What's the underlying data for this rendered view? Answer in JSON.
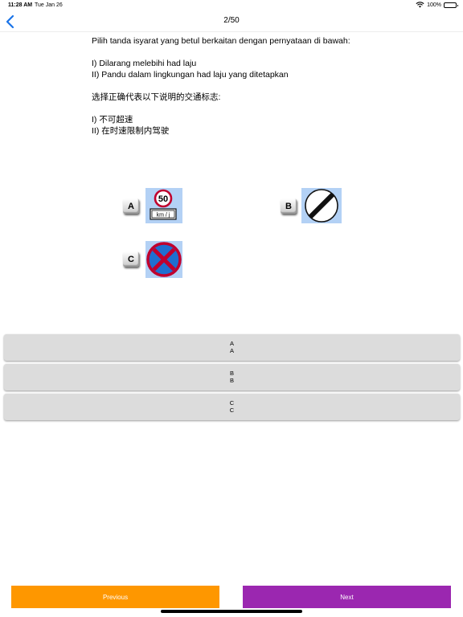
{
  "status_bar": {
    "time": "11:28 AM",
    "date": "Tue Jan 26",
    "battery": "100%"
  },
  "nav": {
    "title": "2/50",
    "back_icon": "chevron-left-icon"
  },
  "question": {
    "malay_intro": "Pilih tanda isyarat yang betul berkaitan dengan pernyataan di bawah:",
    "malay_statements": [
      "I) Dilarang melebihi had laju",
      "II) Pandu dalam lingkungan had laju yang ditetapkan"
    ],
    "chinese_intro": "选择正确代表以下说明的交通标志:",
    "chinese_statements": [
      "I) 不可超速",
      "II) 在时速限制内驾驶"
    ]
  },
  "option_images": [
    {
      "letter": "A",
      "sign": "speed-limit-50-sign",
      "speed": "50",
      "unit": "km / j"
    },
    {
      "letter": "B",
      "sign": "end-of-restriction-sign"
    },
    {
      "letter": "C",
      "sign": "no-stopping-sign"
    }
  ],
  "answers": [
    {
      "line1": "A",
      "line2": "A"
    },
    {
      "line1": "B",
      "line2": "B"
    },
    {
      "line1": "C",
      "line2": "C"
    }
  ],
  "footer": {
    "previous_label": "Previous",
    "next_label": "Next"
  },
  "colors": {
    "previous": "#fe9700",
    "next": "#9b27b0",
    "accent": "#1a73e8",
    "sign_background": "#b3d1f5",
    "answer_background": "#dcdcdc"
  }
}
